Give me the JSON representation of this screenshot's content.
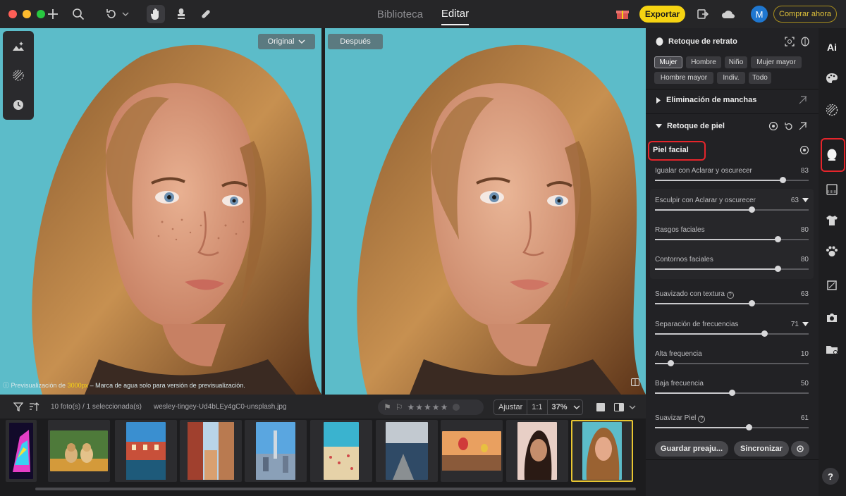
{
  "topbar": {
    "tabs": [
      {
        "label": "Biblioteca",
        "active": false
      },
      {
        "label": "Editar",
        "active": true
      }
    ],
    "export_label": "Exportar",
    "avatar_letter": "M",
    "buy_label": "Comprar ahora"
  },
  "compare": {
    "before_label": "Original",
    "after_label": "Después",
    "preview_note_prefix": "Previsualización de ",
    "preview_note_highlight": "3000px",
    "preview_note_suffix": " – Marca de agua solo para versión de previsualización."
  },
  "filmstrip": {
    "count_text": "10 foto(s) / 1 seleccionada(s)",
    "filename": "wesley-tingey-Ud4bLEy4gC0-unsplash.jpg",
    "fit_label": "Ajustar",
    "one_to_one_label": "1:1",
    "zoom_value": "37%"
  },
  "panel": {
    "portrait_title": "Retoque de retrato",
    "presets": [
      "Mujer",
      "Hombre",
      "Niño",
      "Mujer mayor",
      "Hombre mayor",
      "Indiv.",
      "Todo"
    ],
    "active_preset": "Mujer",
    "blemish_title": "Eliminación de manchas",
    "skin_title": "Retoque de piel",
    "facial_skin_label": "Piel facial",
    "sliders": [
      {
        "label": "Igualar con Aclarar y oscurecer",
        "value": 83
      },
      {
        "label": "Esculpir con Aclarar y oscurecer",
        "value": 63
      },
      {
        "label": "Rasgos faciales",
        "value": 80
      },
      {
        "label": "Contornos faciales",
        "value": 80
      },
      {
        "label": "Suavizado con textura",
        "value": 63
      },
      {
        "label": "Separación de frecuencias",
        "value": 71
      },
      {
        "label": "Alta frequencia",
        "value": 10
      },
      {
        "label": "Baja frecuencia",
        "value": 50
      },
      {
        "label": "Suavizar Piel",
        "value": 61
      }
    ],
    "save_preset_label": "Guardar preaju...",
    "sync_label": "Sincronizar"
  },
  "iconbar": {
    "ai_label": "Ai",
    "help_label": "?"
  }
}
